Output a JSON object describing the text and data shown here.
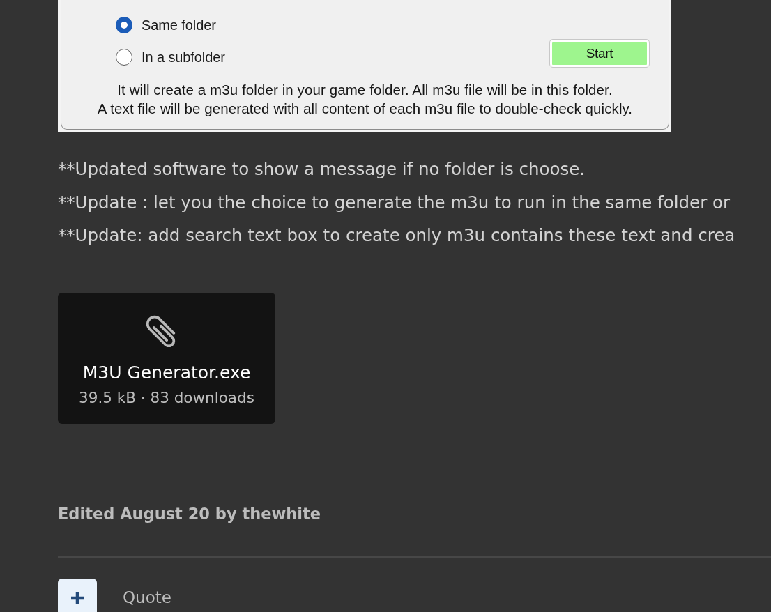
{
  "screenshot": {
    "options": [
      {
        "label": "Same folder",
        "selected": true
      },
      {
        "label": "In a subfolder",
        "selected": false
      }
    ],
    "start_button": "Start",
    "note_lines": [
      "It will create a m3u folder in your game folder. All m3u file will be in this folder.",
      "A text file will be generated with all content of each m3u file to double-check quickly."
    ]
  },
  "updates": [
    "**Updated software to show a message if no folder is choose.",
    "**Update : let you the choice to generate the m3u to run in the same folder or",
    "**Update: add search text box to create only m3u contains these text and crea"
  ],
  "attachment": {
    "file_name": "M3U Generator.exe",
    "meta": "39.5 kB · 83 downloads"
  },
  "edited_note": "Edited August 20 by thewhite",
  "quote_label": "Quote"
}
